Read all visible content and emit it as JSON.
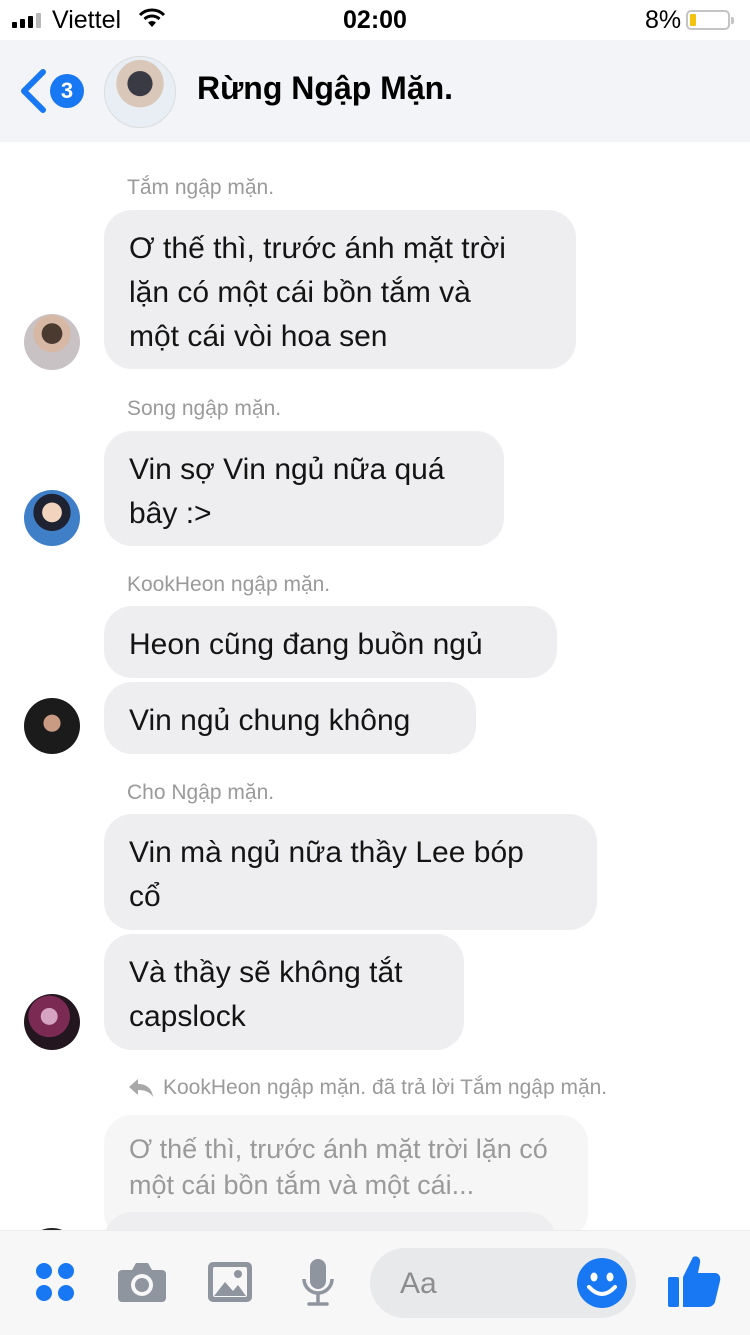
{
  "status_bar": {
    "carrier": "Viettel",
    "time": "02:00",
    "battery": "8%"
  },
  "header": {
    "unread_count": "3",
    "title": "Rừng Ngập Mặn."
  },
  "messages": [
    {
      "sender": "Tắm ngập mặn.",
      "bubbles": [
        "Ơ thế thì, trước ánh mặt trời\nlặn có một cái bồn tắm và\nmột cái vòi hoa sen"
      ]
    },
    {
      "sender": "Song ngập mặn.",
      "bubbles": [
        "Vin sợ Vin ngủ nữa quá\nbây :>"
      ]
    },
    {
      "sender": "KookHeon ngập mặn.",
      "bubbles": [
        "Heon cũng đang buồn ngủ",
        "Vin ngủ chung không"
      ]
    },
    {
      "sender": "Cho Ngập mặn.",
      "bubbles": [
        "Vin mà ngủ nữa thầy Lee bóp\ncổ",
        "Và thầy sẽ không tắt\ncapslock"
      ]
    }
  ],
  "reply": {
    "note": "KookHeon ngập mặn. đã trả lời Tắm ngập mặn.",
    "quoted": "Ơ thế thì, trước ánh mặt trời lặn có một cái bồn tắm và một cái..."
  },
  "composer": {
    "placeholder": "Aa"
  },
  "colors": {
    "accent": "#1877f2",
    "bubble": "#eeeef0",
    "muted_text": "#9a9a9a"
  }
}
